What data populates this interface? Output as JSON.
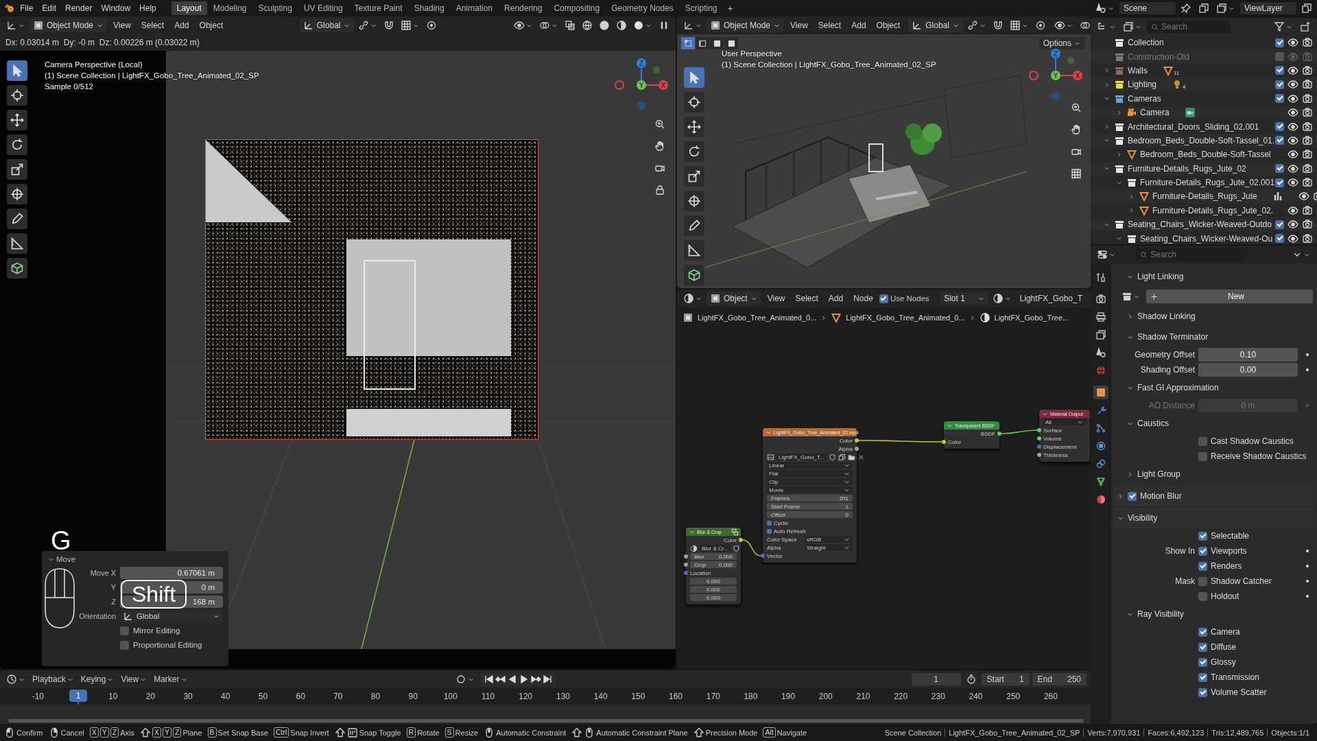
{
  "top_bar": {
    "menus": [
      "File",
      "Edit",
      "Render",
      "Window",
      "Help"
    ],
    "workspaces": [
      {
        "label": "Layout",
        "selected": true
      },
      {
        "label": "Modeling",
        "selected": false
      },
      {
        "label": "Sculpting",
        "selected": false
      },
      {
        "label": "UV Editing",
        "selected": false
      },
      {
        "label": "Texture Paint",
        "selected": false
      },
      {
        "label": "Shading",
        "selected": false
      },
      {
        "label": "Animation",
        "selected": false
      },
      {
        "label": "Rendering",
        "selected": false
      },
      {
        "label": "Compositing",
        "selected": false
      },
      {
        "label": "Geometry Nodes",
        "selected": false
      },
      {
        "label": "Scripting",
        "selected": false
      }
    ],
    "add_workspace": "+"
  },
  "scene_bar": {
    "scene": "Scene",
    "view_layer": "ViewLayer"
  },
  "camera_viewport": {
    "header": {
      "mode": "Object Mode",
      "menus": [
        "View",
        "Select",
        "Add",
        "Object"
      ],
      "orientation": "Global"
    },
    "info": "Dx: 0.03014 m  Dy: -0 m  Dz: 0.00226 m (0.03022 m)",
    "overlay": [
      "Camera Perspective (Local)",
      "(1) Scene Collection | LightFX_Gobo_Tree_Animated_02_SP",
      "Sample 0/512"
    ],
    "axis_labels": [
      "Z",
      "Y",
      "X"
    ],
    "key_overlay": "G",
    "modifier_overlay": "Shift",
    "redo_panel": {
      "title": "Move",
      "expanded": true,
      "fields": [
        {
          "label": "Move X",
          "value": "0.67061 m"
        },
        {
          "label": "Y",
          "value": "0 m"
        },
        {
          "label": "Z",
          "value": "168 m"
        }
      ],
      "orientation_label": "Orientation",
      "orientation": "Global",
      "checks": [
        {
          "label": "Mirror Editing",
          "checked": false
        },
        {
          "label": "Proportional Editing",
          "checked": false
        }
      ]
    }
  },
  "user_viewport": {
    "header": {
      "mode": "Object Mode",
      "menus": [
        "View",
        "Select",
        "Add",
        "Object"
      ],
      "orientation": "Global"
    },
    "options": "Options",
    "overlay": [
      "User Perspective",
      "(1) Scene Collection | LightFX_Gobo_Tree_Animated_02_SP"
    ],
    "axis_labels": [
      "Z",
      "Y",
      "X"
    ]
  },
  "node_editor": {
    "header": {
      "type": "Object",
      "menus": [
        "View",
        "Select",
        "Add",
        "Node"
      ],
      "use_nodes": {
        "label": "Use Nodes",
        "checked": true
      },
      "slot": "Slot 1",
      "material": "LightFX_Gobo_T"
    },
    "breadcrumbs": [
      {
        "kind": "object",
        "label": "LightFX_Gobo_Tree_Animated_0..."
      },
      {
        "kind": "mesh",
        "label": "LightFX_Gobo_Tree_Animated_0..."
      },
      {
        "kind": "material",
        "label": "LightFX_Gobo_Tree..."
      }
    ],
    "nodes": [
      {
        "kind": "group",
        "title": "Blur & Crop",
        "rows": [
          {
            "kind": "output",
            "label": "Color",
            "color": "#c7c729"
          },
          {
            "kind": "group_select",
            "label": "Blur & Cr..."
          },
          {
            "kind": "field",
            "label": "Blur",
            "value": "0.000",
            "color": "#a1a1a1"
          },
          {
            "kind": "field",
            "label": "Crop",
            "value": "0.000",
            "color": "#a1a1a1"
          },
          {
            "kind": "input",
            "label": "Location",
            "color": "#6363c7"
          },
          {
            "kind": "value",
            "value": "0.000"
          },
          {
            "kind": "value",
            "value": "0.000"
          },
          {
            "kind": "value",
            "value": "0.000"
          }
        ]
      },
      {
        "kind": "texture",
        "title": "LightFX_Gobo_Tree_Animated_02.mp4",
        "rows": [
          {
            "kind": "output",
            "label": "Color",
            "color": "#c7c729"
          },
          {
            "kind": "output",
            "label": "Alpha",
            "color": "#a1a1a1"
          },
          {
            "kind": "image",
            "label": "LightFX_Gobo_T..."
          },
          {
            "kind": "select",
            "label": "Linear"
          },
          {
            "kind": "select",
            "label": "Flat"
          },
          {
            "kind": "select",
            "label": "Clip"
          },
          {
            "kind": "select",
            "label": "Movie"
          },
          {
            "kind": "field",
            "label": "Frames",
            "value": "201"
          },
          {
            "kind": "field",
            "label": "Start Frame",
            "value": "1"
          },
          {
            "kind": "field",
            "label": "Offset",
            "value": "0"
          },
          {
            "kind": "check",
            "label": "Cyclic",
            "checked": true
          },
          {
            "kind": "check",
            "label": "Auto Refresh",
            "checked": true
          },
          {
            "kind": "prop",
            "label": "Color Space",
            "value": "sRGB"
          },
          {
            "kind": "prop",
            "label": "Alpha",
            "value": "Straight"
          },
          {
            "kind": "input",
            "label": "Vector",
            "color": "#6363c7"
          }
        ]
      },
      {
        "kind": "shader",
        "title": "Transparent BSDF",
        "rows": [
          {
            "kind": "output",
            "label": "BSDF",
            "color": "#5fcf5f"
          },
          {
            "kind": "input",
            "label": "Color",
            "color": "#c7c729"
          }
        ]
      },
      {
        "kind": "output",
        "title": "Material Output",
        "rows": [
          {
            "kind": "select",
            "label": "All"
          },
          {
            "kind": "input",
            "label": "Surface",
            "color": "#5fcf5f"
          },
          {
            "kind": "input",
            "label": "Volume",
            "color": "#5fcf5f"
          },
          {
            "kind": "input",
            "label": "Displacement",
            "color": "#6363c7"
          },
          {
            "kind": "input",
            "label": "Thickness",
            "color": "#a1a1a1"
          }
        ]
      }
    ]
  },
  "timeline": {
    "menus": [
      "Playback",
      "Keying",
      "View",
      "Marker"
    ],
    "current_frame": "1",
    "start_label": "Start",
    "start": "1",
    "end_label": "End",
    "end": "250",
    "ruler": [
      "-10",
      "10",
      "20",
      "30",
      "40",
      "50",
      "60",
      "70",
      "80",
      "90",
      "100",
      "110",
      "120",
      "130",
      "140",
      "150",
      "160",
      "170",
      "180",
      "190",
      "200",
      "210",
      "220",
      "230",
      "240",
      "250",
      "260"
    ],
    "playhead": "1"
  },
  "outliner": {
    "search_placeholder": "Search",
    "items": [
      {
        "kind": "collection",
        "name": "Collection",
        "color": "#e6e6e6",
        "checked": true,
        "disabled": false
      },
      {
        "kind": "collection",
        "name": "Construction-Old",
        "color": "#7a7a7a",
        "checked": false,
        "disabled": true
      },
      {
        "kind": "collection",
        "name": "Walls",
        "color": "#8a6a5a",
        "expanded": false,
        "checked": true,
        "disabled": false,
        "badge": {
          "kind": "mesh",
          "count": "11"
        }
      },
      {
        "kind": "collection",
        "name": "Lighting",
        "color": "#e8e04a",
        "expanded": false,
        "checked": true,
        "disabled": false,
        "badge": {
          "kind": "light",
          "count": "4"
        }
      },
      {
        "kind": "collection",
        "name": "Cameras",
        "color": "#5aa8e0",
        "expanded": true,
        "checked": true,
        "disabled": false,
        "children": [
          {
            "kind": "camera",
            "name": "Camera",
            "expanded": false,
            "disabled": false,
            "badge": {
              "kind": "camera_data"
            }
          }
        ]
      },
      {
        "kind": "collection",
        "name": "Architectural_Doors_Sliding_02.001",
        "color": "#e6e6e6",
        "expanded": false,
        "checked": true,
        "disabled": false
      },
      {
        "kind": "collection",
        "name": "Bedroom_Beds_Double-Soft-Tassel_01.",
        "color": "#e6e6e6",
        "expanded": true,
        "checked": true,
        "disabled": false,
        "children": [
          {
            "kind": "mesh",
            "name": "Bedroom_Beds_Double-Soft-Tassel",
            "expanded": false,
            "disabled": false
          }
        ]
      },
      {
        "kind": "collection",
        "name": "Furniture-Details_Rugs_Jute_02",
        "color": "#e6e6e6",
        "expanded": true,
        "checked": true,
        "disabled": false,
        "children": [
          {
            "kind": "collection",
            "name": "Furniture-Details_Rugs_Jute_02.001",
            "color": "#e6e6e6",
            "expanded": true,
            "checked": true,
            "disabled": false,
            "children": [
              {
                "kind": "mesh",
                "name": "Furniture-Details_Rugs_Jute",
                "expanded": false,
                "disabled": false,
                "badge": {
                  "kind": "modifier"
                }
              },
              {
                "kind": "mesh",
                "name": "Furniture-Details_Rugs_Jute_02.",
                "expanded": false,
                "disabled": false
              }
            ]
          }
        ]
      },
      {
        "kind": "collection",
        "name": "Seating_Chairs_Wicker-Weaved-Outdo",
        "color": "#e6e6e6",
        "expanded": true,
        "checked": true,
        "disabled": false,
        "children": [
          {
            "kind": "collection",
            "name": "Seating_Chairs_Wicker-Weaved-Ou",
            "color": "#e6e6e6",
            "expanded": true,
            "checked": true,
            "disabled": false
          }
        ]
      }
    ]
  },
  "properties": {
    "search_placeholder": "Search",
    "tabs": [
      {
        "kind": "tool",
        "selected": false
      },
      {
        "kind": "render",
        "selected": false
      },
      {
        "kind": "output",
        "selected": false
      },
      {
        "kind": "view_layer",
        "selected": false
      },
      {
        "kind": "scene",
        "selected": false
      },
      {
        "kind": "world",
        "selected": false
      },
      {
        "kind": "object",
        "selected": true
      },
      {
        "kind": "modifiers",
        "selected": false
      },
      {
        "kind": "particles",
        "selected": false
      },
      {
        "kind": "physics",
        "selected": false
      },
      {
        "kind": "constraints",
        "selected": false
      },
      {
        "kind": "data",
        "selected": false
      },
      {
        "kind": "material",
        "selected": false
      }
    ],
    "rows": [
      {
        "kind": "subpanel",
        "label": "Light Linking",
        "expanded": true
      },
      {
        "kind": "new",
        "label": "New"
      },
      {
        "kind": "subpanel",
        "label": "Shadow Linking",
        "expanded": false
      },
      {
        "kind": "subpanel",
        "label": "Shadow Terminator",
        "expanded": true
      },
      {
        "kind": "number",
        "label": "Geometry Offset",
        "value": "0.10",
        "disabled": false
      },
      {
        "kind": "number",
        "label": "Shading Offset",
        "value": "0.00",
        "disabled": false
      },
      {
        "kind": "subpanel",
        "label": "Fast GI Approximation",
        "expanded": true
      },
      {
        "kind": "number",
        "label": "AO Distance",
        "value": "0 m",
        "disabled": true
      },
      {
        "kind": "subpanel",
        "label": "Caustics",
        "expanded": true
      },
      {
        "kind": "check",
        "label": "Cast Shadow Caustics",
        "checked": false,
        "decorator": false
      },
      {
        "kind": "check",
        "label": "Receive Shadow Caustics",
        "checked": false,
        "decorator": false
      },
      {
        "kind": "subpanel",
        "label": "Light Group",
        "expanded": false
      },
      {
        "kind": "panel",
        "label": "Motion Blur",
        "expanded": false,
        "checked": true
      },
      {
        "kind": "panel",
        "label": "Visibility",
        "expanded": true
      },
      {
        "kind": "check",
        "label": "Selectable",
        "checked": true,
        "decorator": false
      },
      {
        "kind": "check",
        "group": "Show In",
        "label": "Viewports",
        "checked": true,
        "decorator": true
      },
      {
        "kind": "check",
        "label": "Renders",
        "checked": true,
        "decorator": true
      },
      {
        "kind": "check",
        "group": "Mask",
        "label": "Shadow Catcher",
        "checked": false,
        "decorator": true
      },
      {
        "kind": "check",
        "label": "Holdout",
        "checked": false,
        "decorator": true
      },
      {
        "kind": "subpanel",
        "label": "Ray Visibility",
        "expanded": true
      },
      {
        "kind": "check",
        "label": "Camera",
        "checked": true,
        "decorator": false
      },
      {
        "kind": "check",
        "label": "Diffuse",
        "checked": true,
        "decorator": false
      },
      {
        "kind": "check",
        "label": "Glossy",
        "checked": true,
        "decorator": false
      },
      {
        "kind": "check",
        "label": "Transmission",
        "checked": true,
        "decorator": false
      },
      {
        "kind": "check",
        "label": "Volume Scatter",
        "checked": true,
        "decorator": false
      }
    ]
  },
  "status_bar": {
    "hints": [
      {
        "keys": [
          {
            "kind": "mouse_left"
          }
        ],
        "label": "Confirm"
      },
      {
        "keys": [
          {
            "kind": "mouse_right"
          }
        ],
        "label": "Cancel"
      },
      {
        "keys": [
          {
            "kind": "key",
            "text": "X"
          },
          {
            "kind": "key",
            "text": "Y"
          },
          {
            "kind": "key",
            "text": "Z"
          }
        ],
        "label": "Axis"
      },
      {
        "keys": [
          {
            "kind": "shift"
          },
          {
            "kind": "key",
            "text": "X"
          },
          {
            "kind": "key",
            "text": "Y"
          },
          {
            "kind": "key",
            "text": "Z"
          }
        ],
        "label": "Plane"
      },
      {
        "keys": [
          {
            "kind": "key",
            "text": "B"
          }
        ],
        "label": "Set Snap Base"
      },
      {
        "keys": [
          {
            "kind": "key",
            "text": "Ctrl"
          }
        ],
        "label": "Snap Invert"
      },
      {
        "keys": [
          {
            "kind": "shift"
          },
          {
            "kind": "snap"
          }
        ],
        "label": "Snap Toggle"
      },
      {
        "keys": [
          {
            "kind": "key",
            "text": "R"
          }
        ],
        "label": "Rotate"
      },
      {
        "keys": [
          {
            "kind": "key",
            "text": "S"
          }
        ],
        "label": "Resize"
      },
      {
        "keys": [
          {
            "kind": "mouse_middle"
          }
        ],
        "label": "Automatic Constraint"
      },
      {
        "keys": [
          {
            "kind": "shift"
          },
          {
            "kind": "mouse_middle"
          }
        ],
        "label": "Automatic Constraint Plane"
      },
      {
        "keys": [
          {
            "kind": "shift"
          }
        ],
        "label": "Precision Mode"
      },
      {
        "keys": [
          {
            "kind": "key",
            "text": "Alt"
          }
        ],
        "label": "Navigate"
      }
    ],
    "stats": [
      "Scene Collection",
      "LightFX_Gobo_Tree_Animated_02_SP",
      "Verts:7,970,931",
      "Faces:6,492,123",
      "Tris:12,489,765",
      "Objects:1/1"
    ]
  }
}
